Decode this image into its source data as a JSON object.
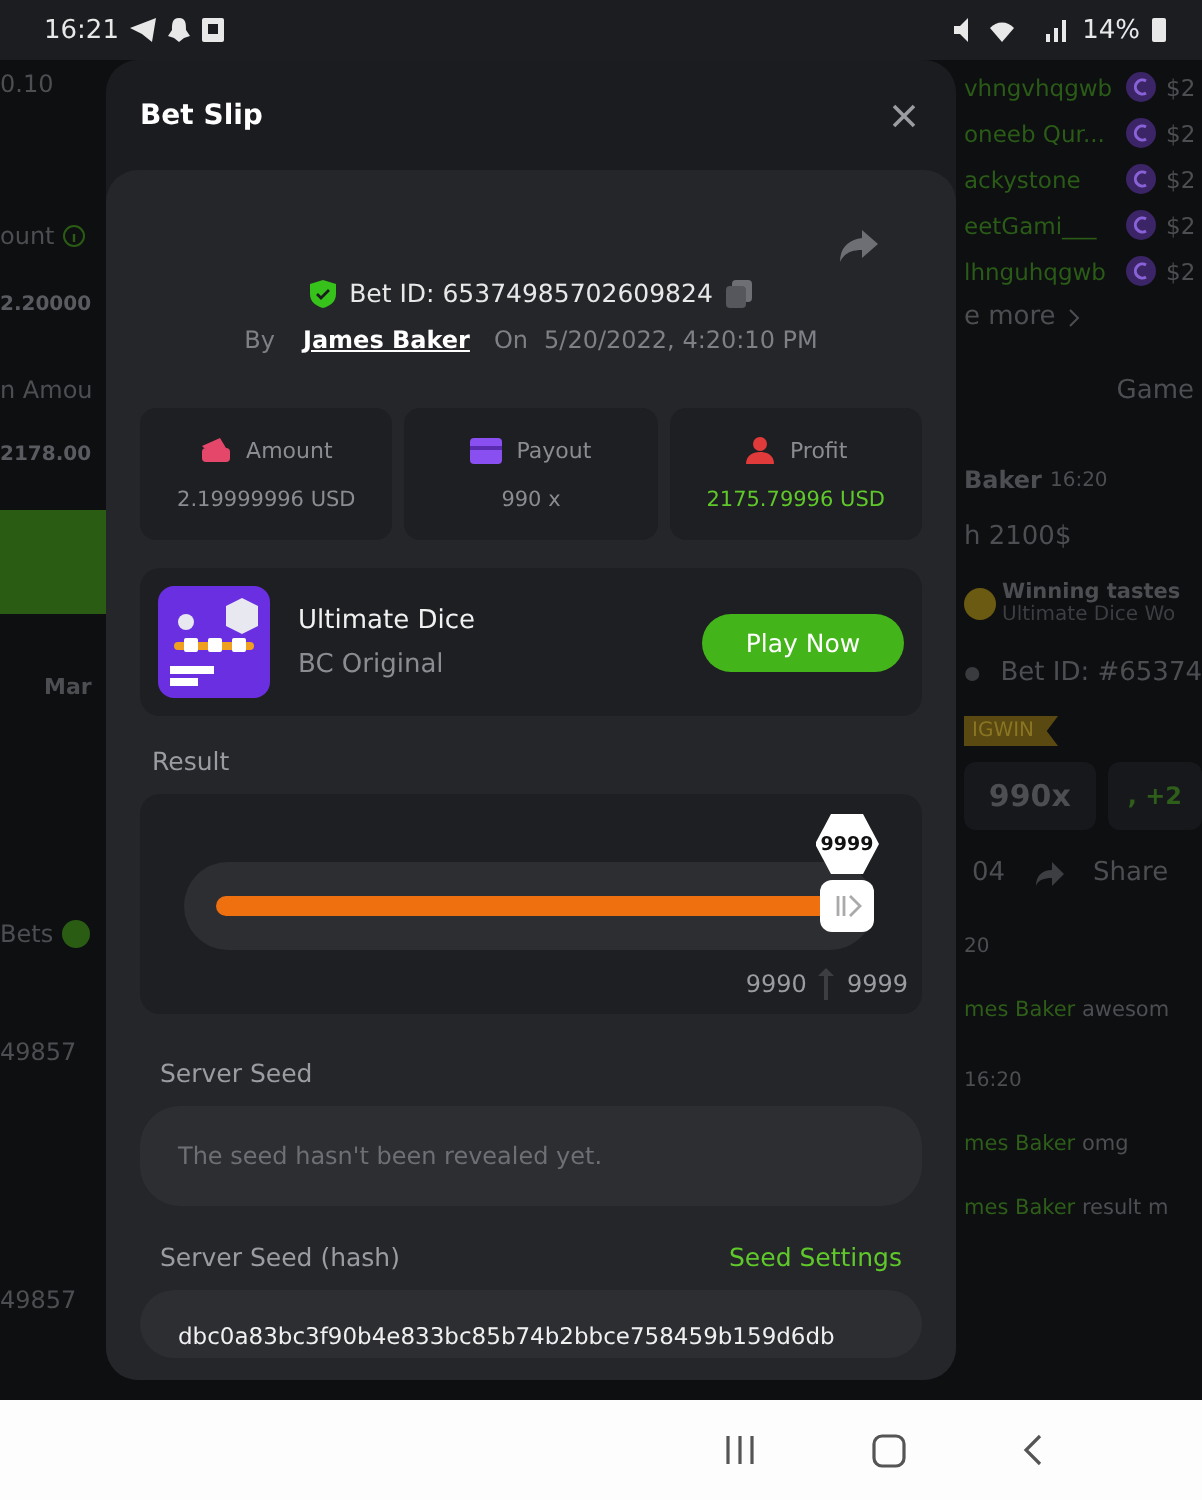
{
  "status_bar": {
    "time": "16:21",
    "battery": "14%"
  },
  "background_left": [
    {
      "kind": "text",
      "text": "0.10"
    },
    {
      "kind": "info",
      "text": "ount"
    },
    {
      "kind": "value",
      "text": "2.20000"
    },
    {
      "kind": "text",
      "text": "n Amou"
    },
    {
      "kind": "value",
      "text": "2178.00"
    },
    {
      "kind": "bar"
    },
    {
      "kind": "tab",
      "text": "Mar"
    },
    {
      "kind": "toggle",
      "text": "Bets"
    },
    {
      "kind": "text",
      "text": "49857"
    },
    {
      "kind": "text",
      "text": "49857"
    }
  ],
  "background_right": {
    "players": [
      {
        "name": "vhngvhqgwb",
        "amount": "$2"
      },
      {
        "name": "oneeb Qur...",
        "amount": "$2"
      },
      {
        "name": "ackystone",
        "amount": "$2"
      },
      {
        "name": "eetGami___",
        "amount": "$2"
      },
      {
        "name": "lhnguhqgwb",
        "amount": "$2"
      }
    ],
    "see_more": "e more",
    "tab": "Game",
    "chat": [
      {
        "kind": "header",
        "name": "Baker",
        "time": "16:20"
      },
      {
        "kind": "message",
        "text": "h 2100$"
      },
      {
        "kind": "share",
        "title": "Winning tastes",
        "subtitle": "Ultimate Dice Wo"
      },
      {
        "kind": "betid",
        "text": "Bet ID: #65374"
      },
      {
        "kind": "bigwin",
        "badge": "IGWIN",
        "value": "990x",
        "extra": ", +2"
      },
      {
        "kind": "actions",
        "count": "04",
        "action": "Share"
      },
      {
        "kind": "time",
        "text": "20"
      },
      {
        "kind": "named",
        "name": "mes Baker",
        "text": "awesom"
      },
      {
        "kind": "time",
        "text": "16:20"
      },
      {
        "kind": "named",
        "name": "mes Baker",
        "text": "omg"
      },
      {
        "kind": "named",
        "name": "mes Baker",
        "text": "result m"
      }
    ]
  },
  "modal": {
    "title": "Bet Slip",
    "bet_id": "Bet ID: 65374985702609824",
    "by_label": "By",
    "user": "James Baker",
    "on_label": "On",
    "date": "5/20/2022, 4:20:10 PM",
    "stats": [
      {
        "kind": "amount",
        "label": "Amount",
        "value": "2.19999996 USD"
      },
      {
        "kind": "payout",
        "label": "Payout",
        "value": "990 x"
      },
      {
        "kind": "profit",
        "label": "Profit",
        "value": "2175.79996 USD"
      }
    ],
    "game": {
      "title": "Ultimate Dice",
      "subtitle": "BC Original",
      "button": "Play Now"
    },
    "result": {
      "label": "Result",
      "level": 1,
      "thumb_value": "9999",
      "low": "9990",
      "high": "9999"
    },
    "server_seed": {
      "label": "Server Seed",
      "value": "The seed hasn't been revealed yet."
    },
    "server_seed_hash": {
      "label": "Server Seed (hash)",
      "link": "Seed Settings",
      "value": "dbc0a83bc3f90b4e833bc85b74b2bbce758459b159d6db"
    }
  }
}
